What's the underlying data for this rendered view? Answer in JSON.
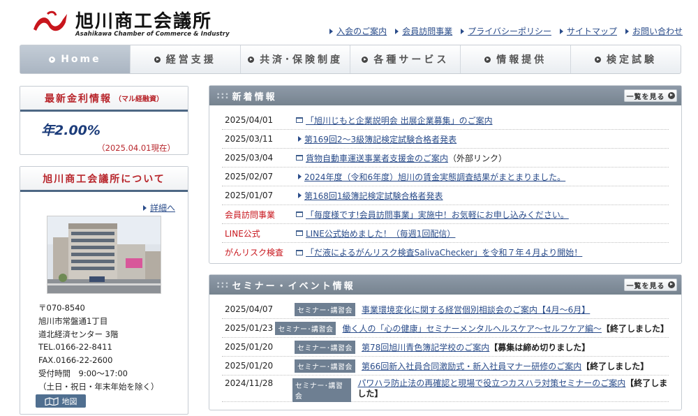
{
  "header": {
    "title": "旭川商工会議所",
    "subtitle": "Asahikawa Chamber of Commerce & Industry",
    "links": [
      "入会のご案内",
      "会員訪問事業",
      "プライバシーポリシー",
      "サイトマップ",
      "お問い合わせ"
    ]
  },
  "nav": {
    "items": [
      "Home",
      "経営支援",
      "共済･保険制度",
      "各種サービス",
      "情報提供",
      "検定試験"
    ],
    "active": "Home"
  },
  "rate_box": {
    "title": "最新金利情報",
    "title_small": "（マル経融資）",
    "value": "年2.00%",
    "as_of": "（2025.04.01現在）"
  },
  "about_box": {
    "title": "旭川商工会議所について",
    "detail_link": "詳細へ",
    "address_lines": [
      "〒070-8540",
      "旭川市常盤通1丁目",
      "道北経済センター 3階",
      "TEL.0166-22-8411",
      "FAX.0166-22-2600",
      "受付時間　9:00～17:00",
      "（土日・祝日・年末年始を除く）"
    ],
    "map_button": "地図"
  },
  "news": {
    "heading": "新着情報",
    "more_label": "一覧を見る",
    "items": [
      {
        "date": "2025/04/01",
        "icon": "window-icon",
        "title": "「旭川じもと企業説明会 出展企業募集」のご案内",
        "extra": "",
        "red": false
      },
      {
        "date": "2025/03/11",
        "icon": "arrow-icon",
        "title": "第169回2～3級簿記検定試験合格者発表",
        "extra": "",
        "red": false
      },
      {
        "date": "2025/03/04",
        "icon": "window-icon",
        "title": "貨物自動車運送事業者支援金のご案内",
        "extra": "（外部リンク）",
        "red": false
      },
      {
        "date": "2025/02/07",
        "icon": "arrow-icon",
        "title": "2024年度（令和6年度）旭川の賃金実態調査結果がまとまりました。",
        "extra": "",
        "red": false
      },
      {
        "date": "2025/01/07",
        "icon": "arrow-icon",
        "title": "第168回1級簿記検定試験合格者発表",
        "extra": "",
        "red": false
      },
      {
        "date": "会員訪問事業",
        "icon": "window-icon",
        "title": "「毎度様です!会員訪問事業」実施中！お気軽にお申し込みください。",
        "extra": "",
        "red": true
      },
      {
        "date": "LINE公式",
        "icon": "window-icon",
        "title": "LINE公式始めました！（毎週1回配信）",
        "extra": "",
        "red": true
      },
      {
        "date": "がんリスク検査",
        "icon": "window-icon",
        "title": "「だ液によるがんリスク検査SalivaChecker」を令和７年４月より開始！",
        "extra": "",
        "red": true
      }
    ]
  },
  "seminars": {
    "heading": "セミナー・イベント情報",
    "more_label": "一覧を見る",
    "badge": "セミナー･講習会",
    "items": [
      {
        "date": "2025/04/07",
        "title": "事業環境変化に関する経営個別相談会のご案内【4月～6月】",
        "extra": ""
      },
      {
        "date": "2025/01/23",
        "title": "働く人の「心の健康」セミナーメンタルヘルスケア～セルフケア編～",
        "extra": "【終了しました】"
      },
      {
        "date": "2025/01/20",
        "title": "第78回旭川青色簿記学校のご案内",
        "extra": "【募集は締め切りました】"
      },
      {
        "date": "2025/01/20",
        "title": "第66回新入社員合同激励式・新入社員マナー研修のご案内",
        "extra": "【終了しました】"
      },
      {
        "date": "2024/11/28",
        "title": "パワハラ防止法の再確認と現場で役立つカスハラ対策セミナーのご案内",
        "extra": "【終了しました】"
      }
    ]
  },
  "colors": {
    "accent_red": "#b8262c",
    "link_blue": "#2a4c8a",
    "panel_gray": "#7f8c99"
  }
}
